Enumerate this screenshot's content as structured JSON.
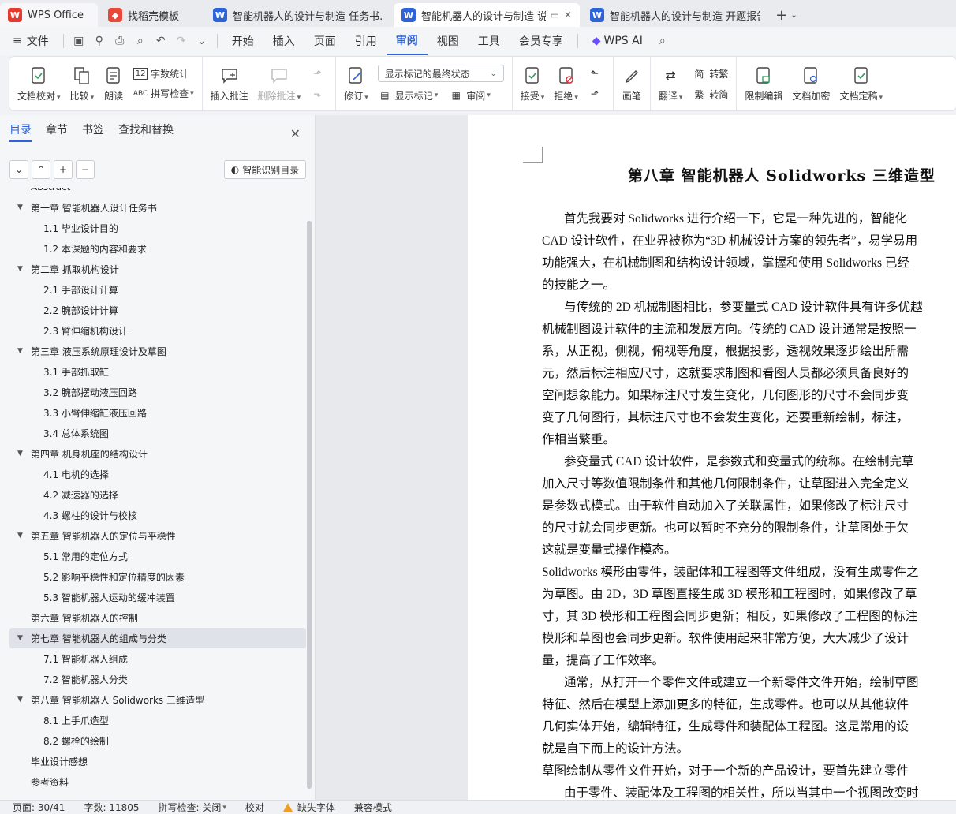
{
  "tabs": {
    "home": "WPS Office",
    "template": "找稻壳模板",
    "doc1": "智能机器人的设计与制造 任务书.docx",
    "doc2": "智能机器人的设计与制造 说明",
    "doc3": "智能机器人的设计与制造 开题报告.docx"
  },
  "menu": {
    "file": "文件",
    "items": [
      "开始",
      "插入",
      "页面",
      "引用",
      "审阅",
      "视图",
      "工具",
      "会员专享"
    ],
    "ai": "WPS AI"
  },
  "ribbon": {
    "doc_check": "文档校对",
    "compare": "比较",
    "read_aloud": "朗读",
    "word_count": "字数统计",
    "spell_check": "拼写检查",
    "insert_comment": "插入批注",
    "delete_comment": "删除批注",
    "track": "修订",
    "markup_select": "显示标记的最终状态",
    "show_markup": "显示标记",
    "review": "审阅",
    "accept": "接受",
    "reject": "拒绝",
    "pen": "画笔",
    "translate": "翻译",
    "to_traditional": "转繁",
    "to_simplified": "转简",
    "restrict_edit": "限制编辑",
    "encrypt": "文档加密",
    "finalize": "文档定稿"
  },
  "panel": {
    "tabs": [
      "目录",
      "章节",
      "书签",
      "查找和替换"
    ],
    "smart_toc": "智能识别目录",
    "toc": [
      {
        "text": "Abstract",
        "level": 0
      },
      {
        "text": "第一章  智能机器人设计任务书",
        "level": 1
      },
      {
        "text": "1.1 毕业设计目的",
        "level": 2
      },
      {
        "text": "1.2 本课题的内容和要求",
        "level": 2
      },
      {
        "text": "第二章  抓取机构设计",
        "level": 1
      },
      {
        "text": "2.1 手部设计计算",
        "level": 2
      },
      {
        "text": "2.2 腕部设计计算",
        "level": 2
      },
      {
        "text": "2.3 臂伸缩机构设计",
        "level": 2
      },
      {
        "text": "第三章  液压系统原理设计及草图",
        "level": 1
      },
      {
        "text": "3.1 手部抓取缸",
        "level": 2
      },
      {
        "text": "3.2 腕部摆动液压回路",
        "level": 2
      },
      {
        "text": "3.3 小臂伸缩缸液压回路",
        "level": 2
      },
      {
        "text": "3.4 总体系统图",
        "level": 2
      },
      {
        "text": "第四章  机身机座的结构设计",
        "level": 1
      },
      {
        "text": "4.1 电机的选择",
        "level": 2
      },
      {
        "text": "4.2 减速器的选择",
        "level": 2
      },
      {
        "text": "4.3 螺柱的设计与校核",
        "level": 2
      },
      {
        "text": "第五章  智能机器人的定位与平稳性",
        "level": 1
      },
      {
        "text": "5.1 常用的定位方式",
        "level": 2
      },
      {
        "text": "5.2 影响平稳性和定位精度的因素",
        "level": 2
      },
      {
        "text": "5.3 智能机器人运动的缓冲装置",
        "level": 2
      },
      {
        "text": "第六章  智能机器人的控制",
        "level": 0
      },
      {
        "text": "第七章  智能机器人的组成与分类",
        "level": 1,
        "selected": true
      },
      {
        "text": "7.1 智能机器人组成",
        "level": 2
      },
      {
        "text": "7.2 智能机器人分类",
        "level": 2
      },
      {
        "text": "第八章  智能机器人 Solidworks 三维造型",
        "level": 1
      },
      {
        "text": "8.1 上手爪造型",
        "level": 2
      },
      {
        "text": " 8.2 螺栓的绘制",
        "level": 2
      },
      {
        "text": "毕业设计感想",
        "level": 0
      },
      {
        "text": "参考资料",
        "level": 0
      }
    ]
  },
  "document": {
    "heading": "第八章  智能机器人 Solidworks 三维造型",
    "lines": [
      {
        "text": "首先我要对 Solidworks 进行介绍一下，它是一种先进的，智能化",
        "indent": true
      },
      {
        "text": "CAD 设计软件，在业界被称为“3D 机械设计方案的领先者”，易学易用",
        "indent": false
      },
      {
        "text": "功能强大，在机械制图和结构设计领域，掌握和使用 Solidworks 已经",
        "indent": false
      },
      {
        "text": "的技能之一。",
        "indent": false
      },
      {
        "text": "与传统的 2D 机械制图相比，参变量式 CAD 设计软件具有许多优越",
        "indent": true
      },
      {
        "text": "机械制图设计软件的主流和发展方向。传统的 CAD 设计通常是按照一",
        "indent": false
      },
      {
        "text": "系，从正视，侧视，俯视等角度，根据投影，透视效果逐步绘出所需",
        "indent": false
      },
      {
        "text": "元，然后标注相应尺寸，这就要求制图和看图人员都必须具备良好的",
        "indent": false
      },
      {
        "text": "空间想象能力。如果标注尺寸发生变化，几何图形的尺寸不会同步变",
        "indent": false
      },
      {
        "text": "变了几何图行，其标注尺寸也不会发生变化，还要重新绘制，标注，",
        "indent": false
      },
      {
        "text": "作相当繁重。",
        "indent": false
      },
      {
        "text": "参变量式 CAD 设计软件，是参数式和变量式的统称。在绘制完草",
        "indent": true
      },
      {
        "text": "加入尺寸等数值限制条件和其他几何限制条件，让草图进入完全定义",
        "indent": false
      },
      {
        "text": "是参数式模式。由于软件自动加入了关联属性，如果修改了标注尺寸",
        "indent": false
      },
      {
        "text": "的尺寸就会同步更新。也可以暂时不充分的限制条件，让草图处于欠",
        "indent": false
      },
      {
        "text": "这就是变量式操作模态。",
        "indent": false
      },
      {
        "text": "Solidworks 模形由零件，装配体和工程图等文件组成，没有生成零件之",
        "indent": false
      },
      {
        "text": "为草图。由 2D，3D 草图直接生成 3D 模形和工程图时，如果修改了草",
        "indent": false
      },
      {
        "text": "寸，其 3D 模形和工程图会同步更新；相反，如果修改了工程图的标注",
        "indent": false
      },
      {
        "text": "模形和草图也会同步更新。软件使用起来非常方便，大大减少了设计",
        "indent": false
      },
      {
        "text": "量，提高了工作效率。",
        "indent": false
      },
      {
        "text": "通常，从打开一个零件文件或建立一个新零件文件开始，绘制草图",
        "indent": true
      },
      {
        "text": "特征、然后在模型上添加更多的特征，生成零件。也可以从其他软件",
        "indent": false
      },
      {
        "text": "几何实体开始，编辑特征，生成零件和装配体工程图。这是常用的设",
        "indent": false
      },
      {
        "text": "就是自下而上的设计方法。",
        "indent": false
      },
      {
        "text": "草图绘制从零件文件开始，对于一个新的产品设计，要首先建立零件",
        "indent": false
      },
      {
        "text": "由于零件、装配体及工程图的相关性，所以当其中一个视图改变时",
        "indent": true
      }
    ]
  },
  "status": {
    "page": "页面: 30/41",
    "words": "字数: 11805",
    "spell": "拼写检查: 关闭",
    "proof": "校对",
    "missing_font": "缺失字体",
    "compat": "兼容模式"
  }
}
